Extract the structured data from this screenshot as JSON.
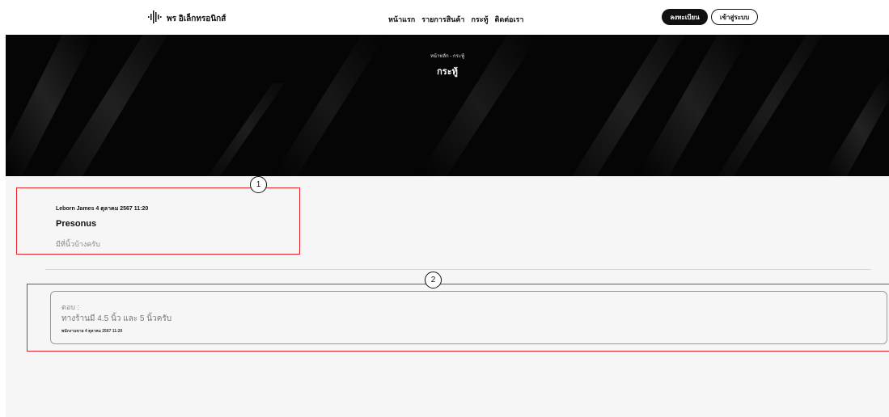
{
  "nav": {
    "brand": "พร อิเล็กทรอนิกส์",
    "links": [
      "หน้าแรก",
      "รายการสินค้า",
      "กระทู้",
      "ติดต่อเรา"
    ],
    "register_label": "ลงทะเบียน",
    "login_label": "เข้าสู่ระบบ"
  },
  "hero": {
    "breadcrumb": "หน้าหลัก - กระทู้",
    "title": "กระทู้"
  },
  "post": {
    "meta": "Leborn James 4 ตุลาคม 2567 11:20",
    "title": "Presonus",
    "body": "มีที่นิ้วบ้างครับ"
  },
  "reply": {
    "label": "ตอบ :",
    "text": "ทางร้านมี 4.5 นิ้ว และ 5 นิ้วครับ",
    "meta": "พนักงานขาย 4 ตุลาคม 2567 11:20"
  },
  "annotations": [
    "1",
    "2"
  ],
  "colors": {
    "annotation_border": "#e8232b",
    "hero_bg": "#050505",
    "content_bg": "#f6f6f6"
  }
}
